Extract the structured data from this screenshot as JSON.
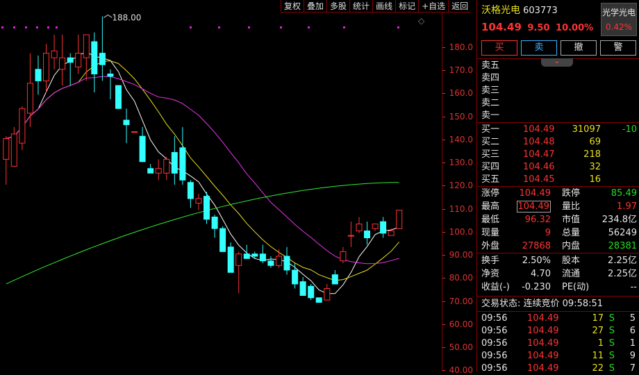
{
  "toolbar": [
    "复权",
    "叠加",
    "多股",
    "统计",
    "画线",
    "标记",
    "+自选",
    "返回"
  ],
  "chart": {
    "max_label": "188.00",
    "y_ticks": [
      "180.0",
      "170.0",
      "160.0",
      "150.0",
      "140.0",
      "130.0",
      "120.0",
      "110.0",
      "100.0",
      "90.00",
      "80.00",
      "70.00",
      "60.00",
      "50.00",
      "40.00"
    ],
    "colors": {
      "up": "#ff3333",
      "down": "#33ffff",
      "ma5": "#ffffff",
      "ma10": "#e8e020",
      "ma20": "#ee33ee",
      "ma60": "#33ee33"
    }
  },
  "chart_data": {
    "type": "candlestick",
    "ylim": [
      40,
      190
    ],
    "candles": [
      [
        126,
        135,
        115,
        136
      ],
      [
        123,
        137,
        132,
        140
      ],
      [
        133,
        148,
        130,
        149
      ],
      [
        146,
        159,
        140,
        172
      ],
      [
        165,
        160,
        154,
        171
      ],
      [
        160,
        172,
        155,
        176
      ],
      [
        170,
        173,
        165,
        180
      ],
      [
        165,
        170,
        158,
        180
      ],
      [
        170,
        168,
        158,
        172
      ],
      [
        166,
        172,
        163,
        180
      ],
      [
        170,
        180,
        160,
        180
      ],
      [
        177,
        163,
        155,
        181
      ],
      [
        172,
        167,
        160,
        188
      ],
      [
        163,
        162,
        152,
        165
      ],
      [
        158,
        148,
        148,
        158
      ],
      [
        143,
        141,
        133,
        148
      ],
      [
        138,
        138,
        138,
        138
      ],
      [
        136,
        125,
        125,
        140
      ],
      [
        122,
        120,
        120,
        124
      ],
      [
        120,
        122,
        117,
        126
      ],
      [
        120,
        126,
        117,
        127
      ],
      [
        129,
        120,
        115,
        136
      ],
      [
        131,
        117,
        115,
        140
      ],
      [
        116,
        109,
        105,
        117
      ],
      [
        107,
        109,
        104,
        111
      ],
      [
        110,
        100,
        98,
        112
      ],
      [
        101,
        96,
        92,
        102
      ],
      [
        96,
        86,
        86,
        97
      ],
      [
        88,
        77,
        77,
        90
      ],
      [
        80,
        85,
        68,
        86
      ],
      [
        85,
        83,
        83,
        89
      ],
      [
        85,
        84,
        83,
        86
      ],
      [
        85,
        82,
        81,
        89
      ],
      [
        82,
        80,
        79,
        84
      ],
      [
        80,
        84,
        79,
        87
      ],
      [
        84,
        78,
        76,
        88
      ],
      [
        78,
        72,
        70,
        81
      ],
      [
        73,
        67,
        67,
        75
      ],
      [
        71,
        66,
        65,
        72
      ],
      [
        66,
        64,
        64,
        66
      ],
      [
        65,
        70,
        65,
        72
      ],
      [
        76,
        72,
        72,
        78
      ],
      [
        82,
        86,
        81,
        88
      ],
      [
        93,
        93,
        88,
        99
      ],
      [
        95,
        98,
        94,
        101
      ],
      [
        95,
        92,
        89,
        99
      ],
      [
        96,
        98,
        95,
        98
      ],
      [
        99,
        94,
        92,
        101
      ],
      [
        93,
        95,
        93,
        96
      ],
      [
        96,
        104,
        96,
        104
      ]
    ],
    "ma_series": [
      "MA5",
      "MA10",
      "MA20",
      "MA60"
    ]
  },
  "quote": {
    "name": "沃格光电",
    "code": "603773",
    "price": "104.49",
    "change": "9.50",
    "pct": "10.00%",
    "sector": "光学光电",
    "sector_pct": "0.42%",
    "buttons": [
      "买",
      "卖",
      "撤",
      "警"
    ]
  },
  "asks": [
    "卖五",
    "卖四",
    "卖三",
    "卖二",
    "卖一"
  ],
  "bids": [
    {
      "label": "买一",
      "price": "104.49",
      "vol": "31097",
      "chg": "-10"
    },
    {
      "label": "买二",
      "price": "104.48",
      "vol": "69",
      "chg": ""
    },
    {
      "label": "买三",
      "price": "104.47",
      "vol": "218",
      "chg": ""
    },
    {
      "label": "买四",
      "price": "104.46",
      "vol": "32",
      "chg": ""
    },
    {
      "label": "买五",
      "price": "104.45",
      "vol": "16",
      "chg": ""
    }
  ],
  "stats1": [
    {
      "l1": "涨停",
      "v1": "104.49",
      "l2": "跌停",
      "v2": "85.49"
    },
    {
      "l1": "最高",
      "v1": "104.49",
      "l2": "量比",
      "v2": "1.97"
    },
    {
      "l1": "最低",
      "v1": "96.32",
      "l2": "市值",
      "v2": "234.8亿"
    },
    {
      "l1": "现量",
      "v1": "9",
      "l2": "总量",
      "v2": "56249"
    },
    {
      "l1": "外盘",
      "v1": "27868",
      "l2": "内盘",
      "v2": "28381"
    }
  ],
  "stats2": [
    {
      "l1": "换手",
      "v1": "2.50%",
      "l2": "股本",
      "v2": "2.25亿"
    },
    {
      "l1": "净资",
      "v1": "4.70",
      "l2": "流通",
      "v2": "2.25亿"
    },
    {
      "l1": "收益(-)",
      "v1": "-0.230",
      "l2": "PE(动)",
      "v2": "--"
    }
  ],
  "status": {
    "label": "交易状态:",
    "text": "连续竞价 09:58:51"
  },
  "ticks": [
    {
      "t": "09:56",
      "p": "104.49",
      "v": "17",
      "s": "S",
      "n": "5"
    },
    {
      "t": "09:56",
      "p": "104.49",
      "v": "27",
      "s": "S",
      "n": "6"
    },
    {
      "t": "09:56",
      "p": "104.49",
      "v": "1",
      "s": "S",
      "n": "1"
    },
    {
      "t": "09:56",
      "p": "104.49",
      "v": "11",
      "s": "S",
      "n": "9"
    },
    {
      "t": "09:56",
      "p": "104.49",
      "v": "22",
      "s": "S",
      "n": "7"
    }
  ]
}
